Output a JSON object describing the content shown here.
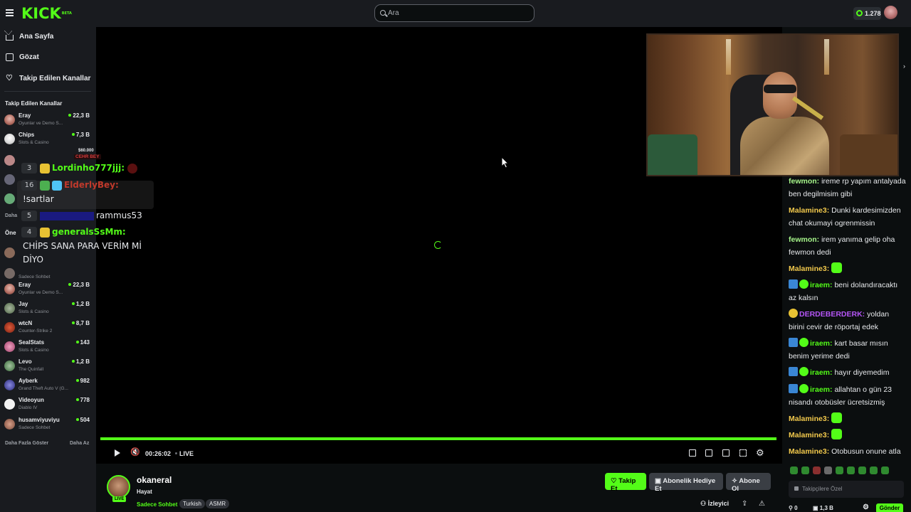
{
  "header": {
    "logo": "KICK",
    "logo_sup": "BETA",
    "search_placeholder": "Ara",
    "balance": "1.278"
  },
  "sidebar": {
    "nav": [
      {
        "label": "Ana Sayfa",
        "icon": "home-icon"
      },
      {
        "label": "Gözat",
        "icon": "browse-icon"
      },
      {
        "label": "Takip Edilen Kanallar",
        "icon": "heart-icon"
      }
    ],
    "followed_heading": "Takip Edilen Kanallar",
    "channels": [
      {
        "name": "Eray",
        "category": "Oyunlar ve Demo S...",
        "viewers": "22,3 B"
      },
      {
        "name": "Chips",
        "category": "Slots & Casino",
        "viewers": "7,3 B"
      },
      {
        "name": "",
        "category": "Sadece Sohbet",
        "viewers": ""
      },
      {
        "name": "Eray",
        "category": "Oyunlar ve Demo S...",
        "viewers": "22,3 B"
      },
      {
        "name": "Jay",
        "category": "Slots & Casino",
        "viewers": "1,2 B"
      },
      {
        "name": "wtcN",
        "category": "Counter-Strike 2",
        "viewers": "8,7 B"
      },
      {
        "name": "SealStats",
        "category": "Slots & Casino",
        "viewers": "143"
      },
      {
        "name": "Levo",
        "category": "The Quinfall",
        "viewers": "1,2 B"
      },
      {
        "name": "Ayberk",
        "category": "Grand Theft Auto V (G...",
        "viewers": "982"
      },
      {
        "name": "Videoyun",
        "category": "Diablo IV",
        "viewers": "778"
      },
      {
        "name": "husamviyuviyu",
        "category": "Sadece Sohbet",
        "viewers": "504"
      }
    ],
    "partial_labels": [
      "Daha",
      "Öne"
    ],
    "show_more": "Daha Fazla Göster",
    "show_less": "Daha Az"
  },
  "overlay_chat": {
    "price": "$60.000",
    "top_name": "CEHR BEY",
    "rows": [
      {
        "count": "3",
        "user": "Lordinho777jjj:",
        "text": ""
      },
      {
        "count": "16",
        "user": "ElderlyBey:",
        "text": "!sartlar"
      },
      {
        "count": "5",
        "user": "",
        "text": "rammus53"
      },
      {
        "count": "4",
        "user": "generalsSsMm:",
        "text": "CHİPS SANA PARA VERİM Mİ DİYO"
      }
    ]
  },
  "player": {
    "time": "00:26:02",
    "live_label": "LIVE",
    "progress": 1.0
  },
  "stream": {
    "channel_name": "okaneral",
    "category": "Hayat",
    "subcategory": "Sadece Sohbet",
    "live_badge": "LIVE",
    "tags": [
      "Turkish",
      "ASMR"
    ],
    "follow_label": "Takip Et",
    "gift_label": "Abonelik Hediye Et",
    "subscribe_label": "Abone Ol",
    "viewers_label": "İzleyici"
  },
  "chat": {
    "messages": [
      {
        "user": "fewmon:",
        "color": "#a6f58a",
        "text": "ireme rp yapım antalyada ben degilmisim gibi"
      },
      {
        "user": "Malamine3:",
        "color": "#f2c94c",
        "text": "Dunki kardesimizden chat okumayi ogrenmissin"
      },
      {
        "user": "fewmon:",
        "color": "#a6f58a",
        "text": "irem yanıma gelip oha fewmon dedi"
      },
      {
        "user": "Malamine3:",
        "color": "#f2c94c",
        "text": ""
      },
      {
        "user": "iraem:",
        "color": "#53fc18",
        "text": "beni dolandıracaktı az kalsın"
      },
      {
        "user": "DERDEBERDERK:",
        "color": "#b455f5",
        "text": "yoldan birini cevir de röportaj edek"
      },
      {
        "user": "iraem:",
        "color": "#53fc18",
        "text": "kart basar mısın benim yerime dedi"
      },
      {
        "user": "iraem:",
        "color": "#53fc18",
        "text": "hayır diyemedim"
      },
      {
        "user": "iraem:",
        "color": "#53fc18",
        "text": "allahtan o gün 23 nisandı otobüsler ücretsizmiş"
      },
      {
        "user": "Malamine3:",
        "color": "#f2c94c",
        "text": ""
      },
      {
        "user": "Malamine3:",
        "color": "#f2c94c",
        "text": ""
      },
      {
        "user": "Malamine3:",
        "color": "#f2c94c",
        "text": "Otobusun onune atla"
      }
    ],
    "input_placeholder": "Takipçilere Özel",
    "points": "0",
    "balance": "1,3 B",
    "send_label": "Gönder"
  },
  "colors": {
    "accent": "#53fc18",
    "background": "#0b0e0f",
    "panel": "#191b1f"
  }
}
